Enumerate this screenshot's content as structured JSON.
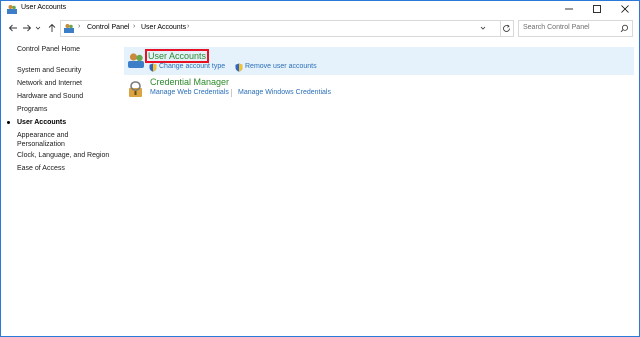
{
  "window": {
    "title": "User Accounts"
  },
  "titlebar_buttons": {
    "minimize_icon": "minimize-icon",
    "maximize_icon": "maximize-icon",
    "close_icon": "close-icon"
  },
  "nav": {
    "breadcrumbs": [
      "Control Panel",
      "User Accounts"
    ],
    "search_placeholder": "Search Control Panel"
  },
  "sidebar": {
    "items": [
      {
        "label": "Control Panel Home"
      },
      {
        "label": "System and Security"
      },
      {
        "label": "Network and Internet"
      },
      {
        "label": "Hardware and Sound"
      },
      {
        "label": "Programs"
      },
      {
        "label": "User Accounts",
        "active": true
      },
      {
        "label": "Appearance and"
      },
      {
        "label": "Personalization"
      },
      {
        "label": "Clock, Language, and Region"
      },
      {
        "label": "Ease of Access"
      }
    ]
  },
  "main": {
    "categories": [
      {
        "title": "User Accounts",
        "links": [
          "Change account type",
          "Remove user accounts"
        ]
      },
      {
        "title": "Credential Manager",
        "links": [
          "Manage Web Credentials",
          "Manage Windows Credentials"
        ]
      }
    ]
  },
  "colors": {
    "link": "#2a6fb8",
    "category_title": "#2b8a2b",
    "highlight": "#e5f1fb",
    "selection_box": "#e81123"
  }
}
